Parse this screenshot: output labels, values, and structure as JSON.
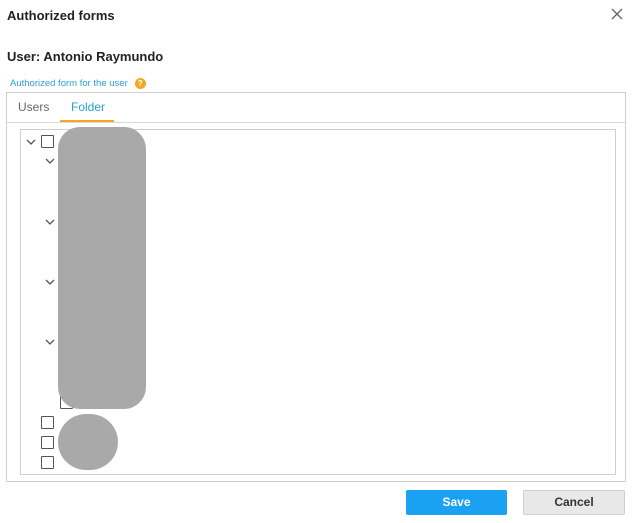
{
  "dialog": {
    "title": "Authorized forms",
    "user_heading": "User: Antonio Raymundo",
    "section_label": "Authorized form for the user",
    "help_icon": "?"
  },
  "tabs": [
    {
      "label": "Users",
      "active": false
    },
    {
      "label": "Folder",
      "active": true
    }
  ],
  "colors": {
    "accent_blue": "#1ba1f2",
    "tab_active_text": "#2a9fd6",
    "tab_underline": "#f5a623",
    "help_icon_bg": "#f5a623",
    "redaction": "#a9a9a9"
  },
  "icons": {
    "close": "close-icon",
    "help": "help-icon",
    "expand": "chevron-down-icon"
  },
  "footer": {
    "save_label": "Save",
    "cancel_label": "Cancel"
  }
}
